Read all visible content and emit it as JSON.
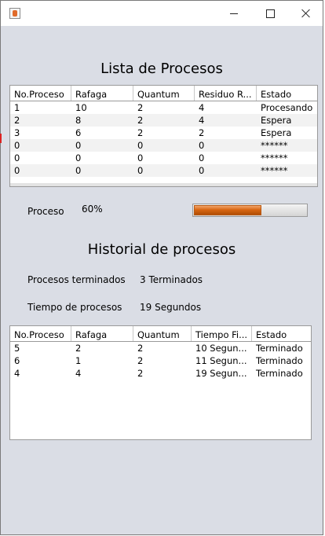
{
  "window": {
    "title": "",
    "controls": [
      "minimize",
      "maximize",
      "close"
    ]
  },
  "main": {
    "title": "Lista de Procesos",
    "columns": [
      "No.Proceso",
      "Rafaga",
      "Quantum",
      "Residuo R...",
      "Estado"
    ],
    "rows": [
      [
        "1",
        "10",
        "2",
        "4",
        "Procesando"
      ],
      [
        "2",
        "8",
        "2",
        "4",
        "Espera"
      ],
      [
        "3",
        "6",
        "2",
        "2",
        "Espera"
      ],
      [
        "0",
        "0",
        "0",
        "0",
        "******"
      ],
      [
        "0",
        "0",
        "0",
        "0",
        "******"
      ],
      [
        "0",
        "0",
        "0",
        "0",
        "******"
      ]
    ]
  },
  "progress": {
    "label": "Proceso",
    "value_text": "60%",
    "fraction": 0.6,
    "fill_color": "#d86712"
  },
  "history": {
    "title": "Historial de procesos",
    "finished_label": "Procesos terminados",
    "finished_value": "3 Terminados",
    "time_label": "Tiempo de procesos",
    "time_value": "19 Segundos",
    "columns": [
      "No.Proceso",
      "Rafaga",
      "Quantum",
      "Tiempo Fi...",
      "Estado"
    ],
    "rows": [
      [
        "5",
        "2",
        "2",
        "10 Segun...",
        "Terminado"
      ],
      [
        "6",
        "1",
        "2",
        "11 Segun...",
        "Terminado"
      ],
      [
        "4",
        "4",
        "2",
        "19 Segun...",
        "Terminado"
      ]
    ]
  }
}
